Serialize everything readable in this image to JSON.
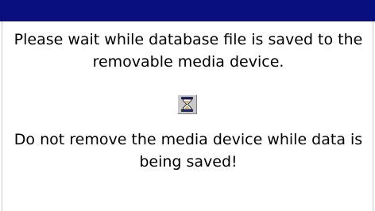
{
  "dialog": {
    "message": "Please wait while database file is saved to the removable media device.",
    "icon": "hourglass-icon",
    "warning": "Do not remove the media device while data is being saved!"
  },
  "colors": {
    "titlebar": "#0a0f80",
    "background": "#ffffff",
    "text": "#000000",
    "icon_frame": "#c8c8c8"
  }
}
